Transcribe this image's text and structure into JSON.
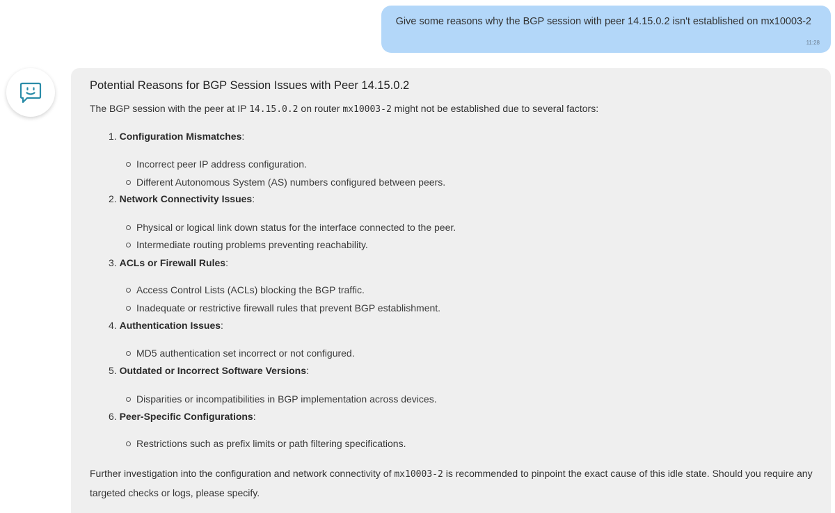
{
  "user_message": {
    "text": "Give some reasons why the BGP session with peer 14.15.0.2 isn't established on mx10003-2",
    "time": "11:28"
  },
  "bot": {
    "avatar_icon": "chat-smile-icon"
  },
  "response": {
    "title": "Potential Reasons for BGP Session Issues with Peer 14.15.0.2",
    "intro": {
      "part1": "The BGP session with the peer at IP ",
      "ip": "14.15.0.2",
      "part2": " on router ",
      "router": "mx10003-2",
      "part3": " might not be established due to several factors:"
    },
    "items": [
      {
        "num": "1. ",
        "title": "Configuration Mismatches",
        "suffix": ":",
        "bullets": [
          "Incorrect peer IP address configuration.",
          "Different Autonomous System (AS) numbers configured between peers."
        ]
      },
      {
        "num": "2. ",
        "title": "Network Connectivity Issues",
        "suffix": ":",
        "bullets": [
          "Physical or logical link down status for the interface connected to the peer.",
          "Intermediate routing problems preventing reachability."
        ]
      },
      {
        "num": "3. ",
        "title": "ACLs or Firewall Rules",
        "suffix": ":",
        "bullets": [
          "Access Control Lists (ACLs) blocking the BGP traffic.",
          "Inadequate or restrictive firewall rules that prevent BGP establishment."
        ]
      },
      {
        "num": "4. ",
        "title": "Authentication Issues",
        "suffix": ":",
        "bullets": [
          "MD5 authentication set incorrect or not configured."
        ]
      },
      {
        "num": "5. ",
        "title": "Outdated or Incorrect Software Versions",
        "suffix": ":",
        "bullets": [
          "Disparities or incompatibilities in BGP implementation across devices."
        ]
      },
      {
        "num": "6. ",
        "title": "Peer-Specific Configurations",
        "suffix": ":",
        "bullets": [
          "Restrictions such as prefix limits or path filtering specifications."
        ]
      }
    ],
    "outro": {
      "part1": "Further investigation into the configuration and network connectivity of ",
      "router": "mx10003-2",
      "part2": " is recommended to pinpoint the exact cause of this idle state. Should you require any targeted checks or logs, please specify."
    }
  },
  "colors": {
    "user_bubble": "#b3d7f9",
    "response_bg": "#efefef",
    "icon_teal": "#2a8ca8"
  }
}
